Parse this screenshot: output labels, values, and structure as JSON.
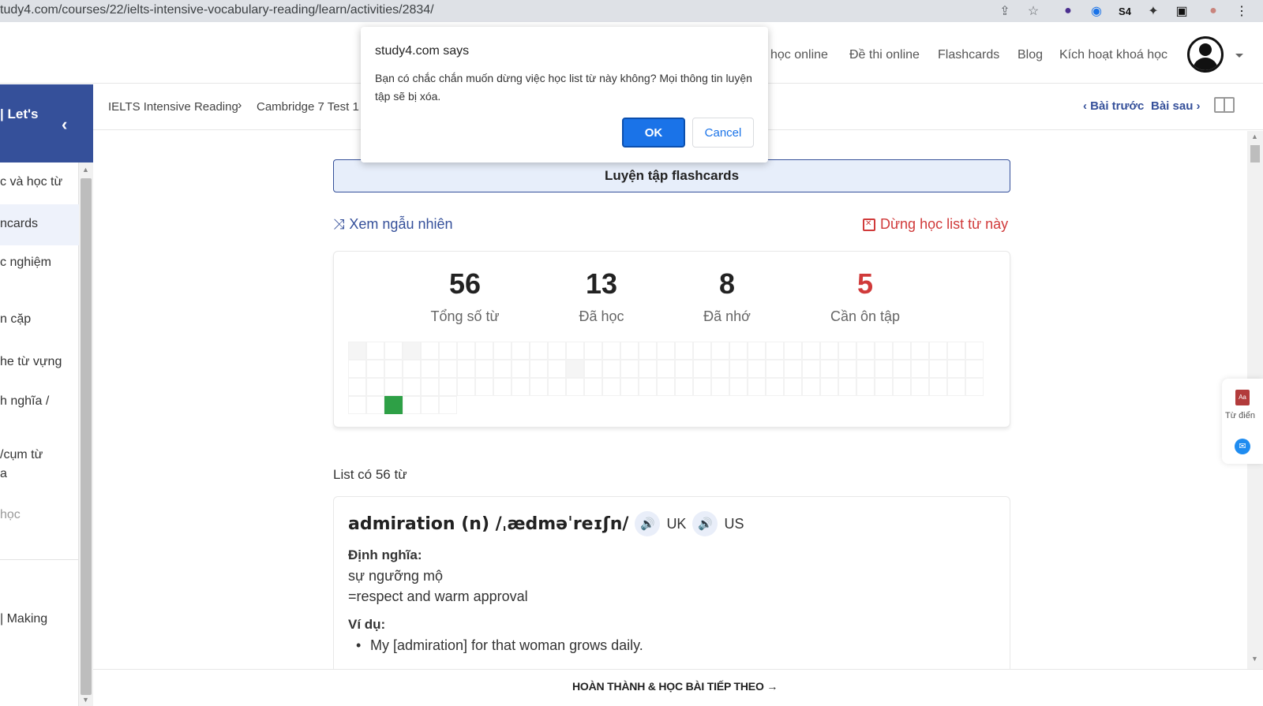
{
  "browser": {
    "url": "tudy4.com/courses/22/ielts-intensive-vocabulary-reading/learn/activities/2834/",
    "extension_icons": [
      "share-icon",
      "star-icon",
      "download-icon",
      "shazam-icon",
      "s4-icon",
      "puzzle-icon",
      "sidebar-icon",
      "profile-icon",
      "menu-icon"
    ]
  },
  "nav": {
    "courses": "học online",
    "exams": "Đề thi online",
    "flashcards": "Flashcards",
    "blog": "Blog",
    "activate": "Kích hoạt khoá học"
  },
  "sidebar": {
    "title": "| Let's",
    "back_glyph": "‹",
    "items": [
      {
        "label": "c và học từ"
      },
      {
        "label": "ncards"
      },
      {
        "label": "c nghiệm"
      },
      {
        "label": "n cặp"
      },
      {
        "label": "he từ vựng"
      },
      {
        "label": "h nghĩa /"
      },
      {
        "label": "/cụm từ"
      },
      {
        "label": "a"
      },
      {
        "label": "học"
      },
      {
        "label": "| Making"
      }
    ]
  },
  "breadcrumb": {
    "course": "IELTS Intensive Reading",
    "lesson": "Cambridge 7 Test 1",
    "prev": "Bài trước",
    "next": "Bài sau"
  },
  "main": {
    "practice_label": "Luyện tập flashcards",
    "shuffle_label": "Xem ngẫu nhiên",
    "stop_label": "Dừng học list từ này",
    "stats": {
      "total": {
        "value": "56",
        "label": "Tổng số từ"
      },
      "learned": {
        "value": "13",
        "label": "Đã học"
      },
      "remembered": {
        "value": "8",
        "label": "Đã nhớ"
      },
      "review": {
        "value": "5",
        "label": "Cần ôn tập"
      }
    },
    "list_title": "List có 56 từ",
    "word": {
      "headword": "admiration (n) /ˌædməˈreɪʃn/",
      "uk": "UK",
      "us": "US",
      "definition_label": "Định nghĩa:",
      "definition_vi": "sự ngưỡng mộ",
      "definition_en": "=respect and warm approval",
      "example_label": "Ví dụ:",
      "example": "My [admiration] for that woman grows daily."
    }
  },
  "bottom": {
    "complete_label": "HOÀN THÀNH & HỌC BÀI TIẾP THEO →"
  },
  "tools": {
    "dictionary_label": "Từ điển"
  },
  "dialog": {
    "title": "study4.com says",
    "message": "Bạn có chắc chắn muốn dừng việc học list từ này không? Mọi thông tin luyện tập sẽ bị xóa.",
    "ok": "OK",
    "cancel": "Cancel"
  },
  "colors": {
    "brand": "#35509a",
    "danger": "#d03a3a",
    "learned_cell": "#2ea046",
    "dialog_primary": "#1a73e8"
  }
}
